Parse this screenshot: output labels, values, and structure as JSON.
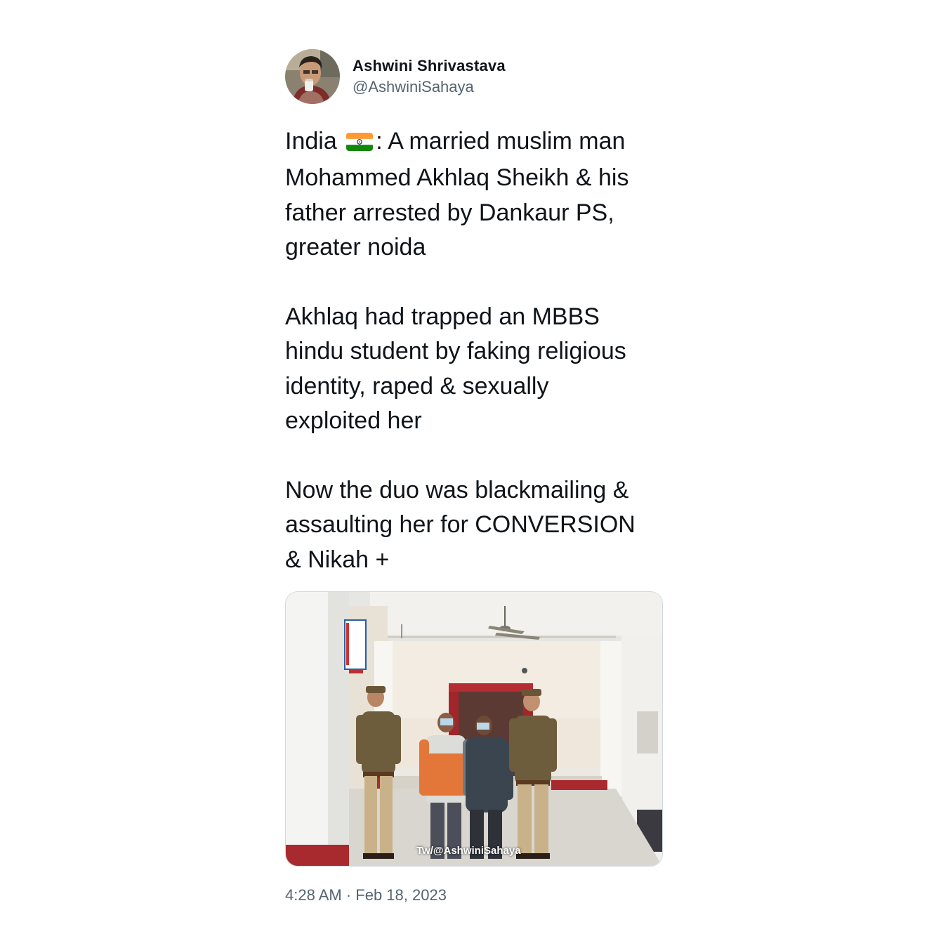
{
  "author": {
    "display_name": "Ashwini Shrivastava",
    "handle": "@AshwiniSahaya"
  },
  "tweet": {
    "lines": [
      {
        "before_flag": "India ",
        "after_flag": ": A married muslim man"
      },
      "Mohammed Akhlaq Sheikh & his",
      "father arrested by Dankaur PS,",
      "greater noida",
      "",
      "Akhlaq had trapped an MBBS",
      "hindu student by faking religious",
      "identity, raped & sexually",
      "exploited her",
      "",
      "Now the duo was blackmailing &",
      "assaulting her for CONVERSION",
      "& Nikah +"
    ],
    "flag_icon": "india-flag-icon"
  },
  "media": {
    "watermark": "Tw/@AshwiniSahaya"
  },
  "timestamp": "4:28 AM · Feb 18, 2023",
  "colors": {
    "text": "#0f1419",
    "secondary": "#536471",
    "border": "#cfd9de"
  }
}
